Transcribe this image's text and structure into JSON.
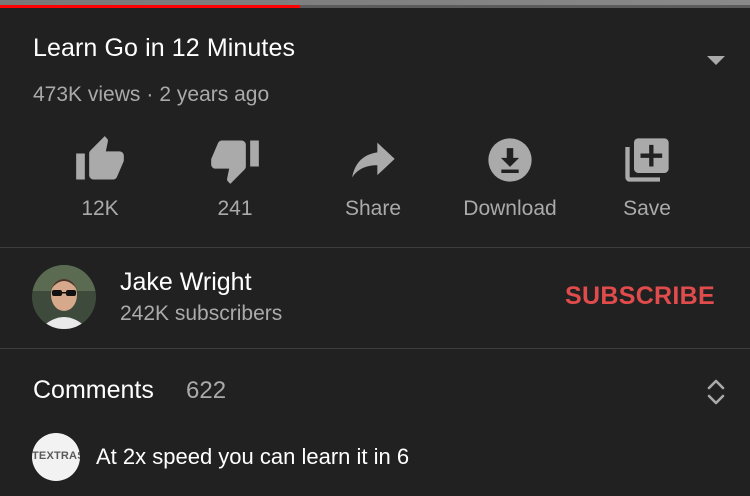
{
  "video": {
    "title": "Learn Go in 12 Minutes",
    "views": "473K views",
    "age": "2 years ago",
    "progress": 0.4
  },
  "actions": [
    {
      "label": "12K",
      "icon": "thumbs-up-icon"
    },
    {
      "label": "241",
      "icon": "thumbs-down-icon"
    },
    {
      "label": "Share",
      "icon": "share-icon"
    },
    {
      "label": "Download",
      "icon": "download-icon"
    },
    {
      "label": "Save",
      "icon": "add-to-playlist-icon"
    }
  ],
  "channel": {
    "name": "Jake Wright",
    "subscribers": "242K subscribers",
    "subscribe_label": "SUBSCRIBE"
  },
  "comments": {
    "title": "Comments",
    "count": "622",
    "first": {
      "avatar_text": "TEXTRAS",
      "text": "At 2x speed you can learn it in 6"
    }
  },
  "colors": {
    "background": "#212121",
    "subscribe": "#e04b4b",
    "progress": "#ff0000",
    "secondary_text": "#aaaaaa"
  }
}
